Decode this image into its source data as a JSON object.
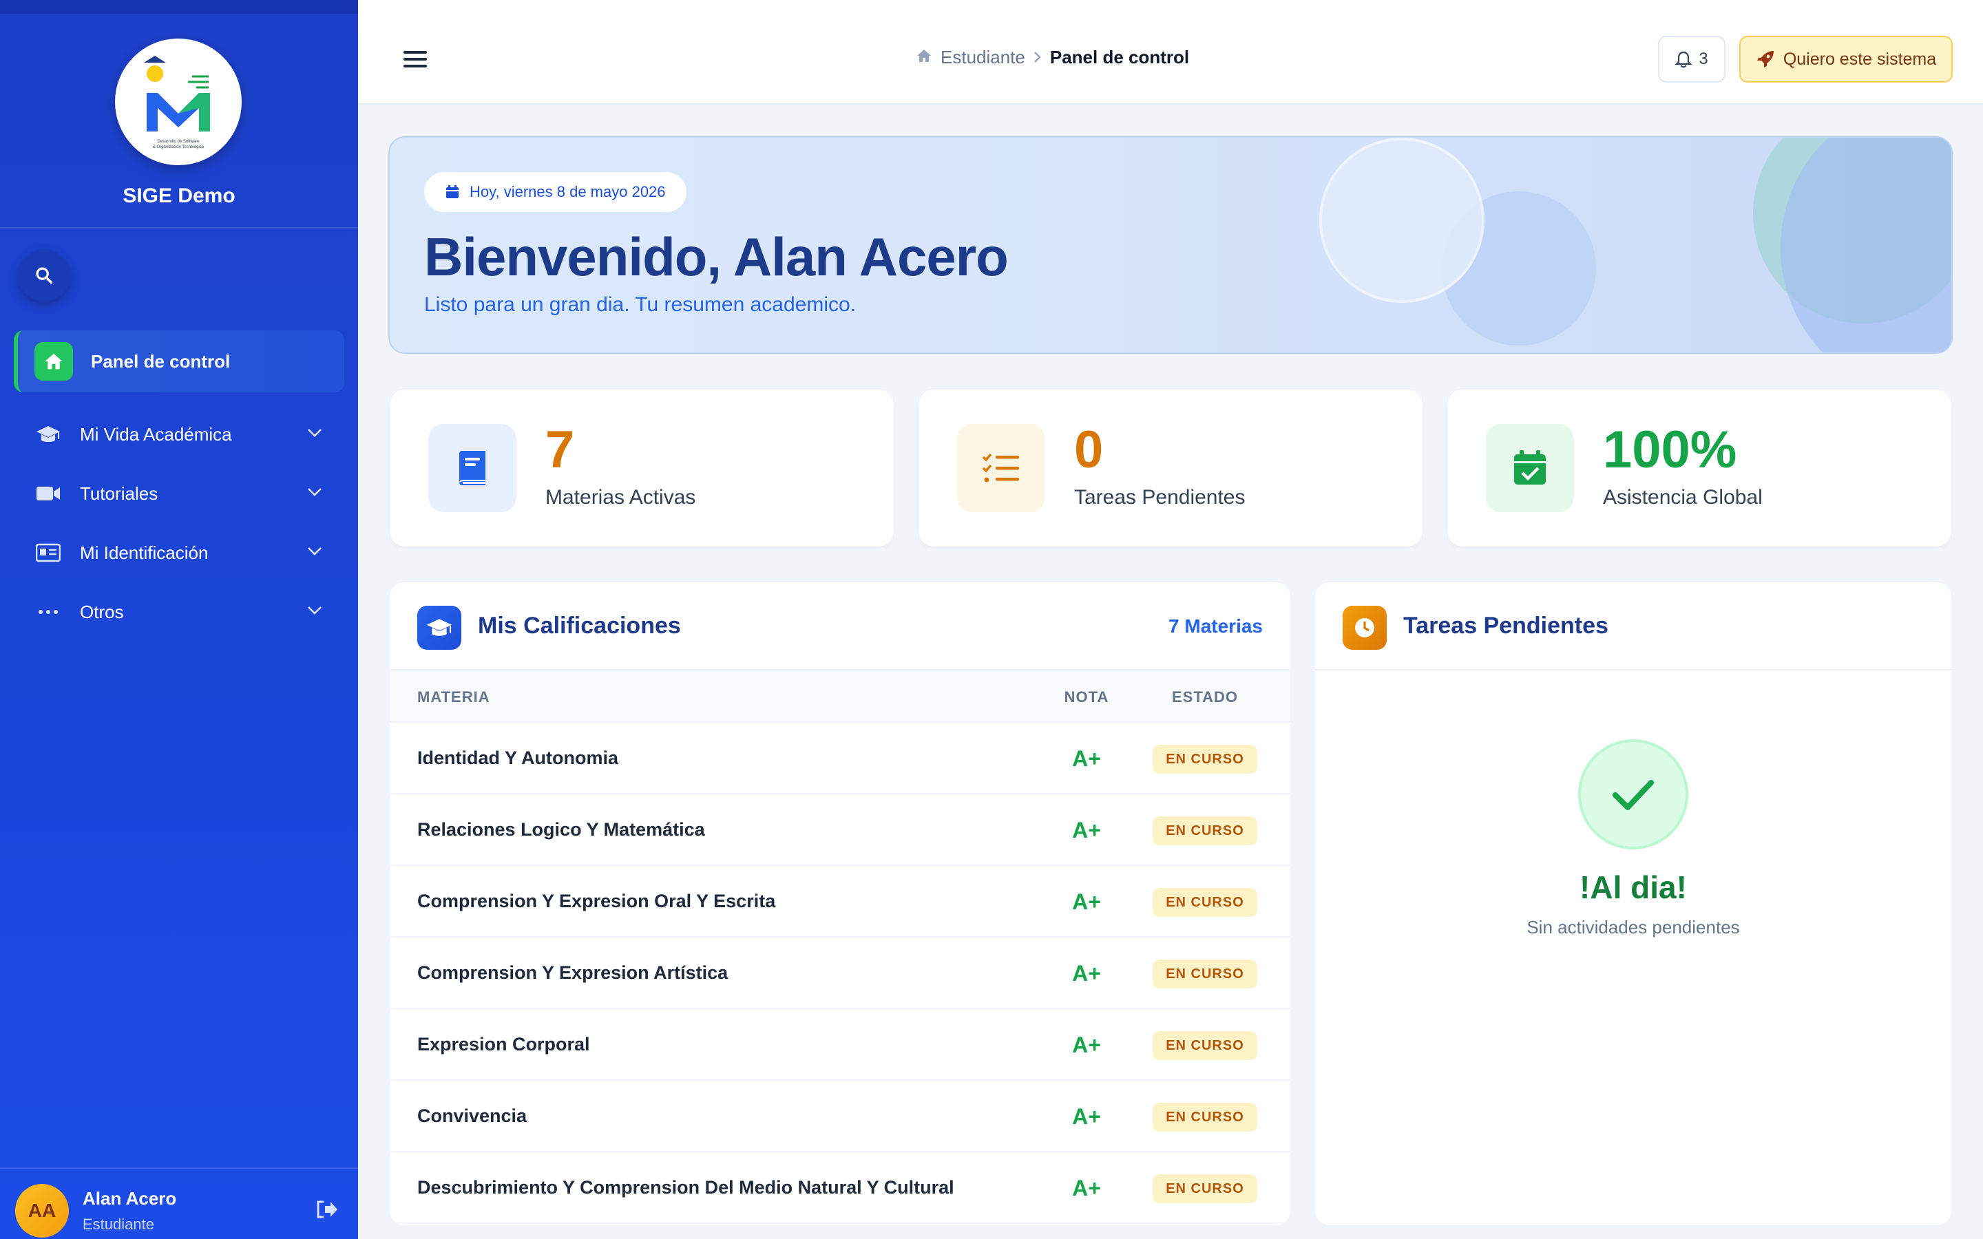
{
  "sidebar": {
    "brand_name": "SIGE Demo",
    "logo_caption_1": "Desarrollo de Software",
    "logo_caption_2": "& Organización Tecnológica",
    "active_item": {
      "label": "Panel de control",
      "icon": "home-icon"
    },
    "items": [
      {
        "label": "Mi Vida Académica",
        "icon": "graduation-cap-icon"
      },
      {
        "label": "Tutoriales",
        "icon": "video-camera-icon"
      },
      {
        "label": "Mi Identificación",
        "icon": "id-card-icon"
      },
      {
        "label": "Otros",
        "icon": "ellipsis-icon"
      }
    ],
    "user": {
      "initials": "AA",
      "name": "Alan Acero",
      "role": "Estudiante"
    }
  },
  "topbar": {
    "breadcrumb": {
      "root": "Estudiante",
      "current": "Panel de control"
    },
    "notifications_count": "3",
    "cta_label": "Quiero este sistema"
  },
  "welcome": {
    "date": "Hoy, viernes 8 de mayo 2026",
    "title": "Bienvenido, Alan Acero",
    "subtitle": "Listo para un gran dia. Tu resumen academico."
  },
  "stats": [
    {
      "value": "7",
      "label": "Materias Activas",
      "color": "#d97706",
      "icon": "book-icon"
    },
    {
      "value": "0",
      "label": "Tareas Pendientes",
      "color": "#d97706",
      "icon": "task-list-icon"
    },
    {
      "value": "100%",
      "label": "Asistencia Global",
      "color": "#16a34a",
      "icon": "calendar-check-icon"
    }
  ],
  "grades": {
    "title": "Mis Calificaciones",
    "count": "7 Materias",
    "columns": {
      "subject": "MATERIA",
      "grade": "NOTA",
      "status": "ESTADO"
    },
    "rows": [
      {
        "subject": "Identidad Y Autonomia",
        "grade": "A+",
        "status": "EN CURSO"
      },
      {
        "subject": "Relaciones Logico Y Matemática",
        "grade": "A+",
        "status": "EN CURSO"
      },
      {
        "subject": "Comprension Y Expresion Oral Y Escrita",
        "grade": "A+",
        "status": "EN CURSO"
      },
      {
        "subject": "Comprension Y Expresion Artística",
        "grade": "A+",
        "status": "EN CURSO"
      },
      {
        "subject": "Expresion Corporal",
        "grade": "A+",
        "status": "EN CURSO"
      },
      {
        "subject": "Convivencia",
        "grade": "A+",
        "status": "EN CURSO"
      },
      {
        "subject": "Descubrimiento Y Comprension Del Medio Natural Y Cultural",
        "grade": "A+",
        "status": "EN CURSO"
      }
    ]
  },
  "tasks": {
    "title": "Tareas Pendientes",
    "empty_title": "!Al dia!",
    "empty_subtitle": "Sin actividades pendientes"
  },
  "colors": {
    "sidebar": "#1d3fc9",
    "accent_green": "#22c55e",
    "heading_blue": "#1e3a8a",
    "warning": "#d97706"
  }
}
